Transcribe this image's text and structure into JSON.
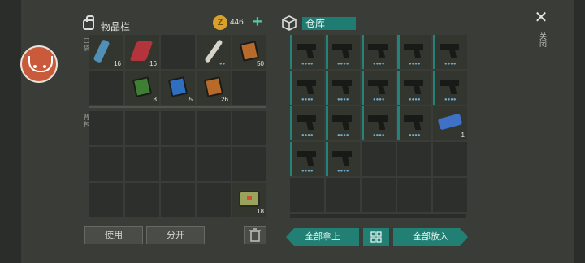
{
  "inventory": {
    "title": "物品栏",
    "coins": "446",
    "pocket_label": "口袋",
    "backpack_label": "背包",
    "pocket_items": [
      {
        "name": "water-bottle",
        "qty": "16",
        "color": "#4f8fb8"
      },
      {
        "name": "red-cloth",
        "qty": "16",
        "color": "#b3343a"
      },
      {
        "name": "empty",
        "qty": ""
      },
      {
        "name": "machete",
        "qty": "",
        "color": "#d6d3c8"
      },
      {
        "name": "notebook-orange",
        "qty": "50",
        "color": "#b86a2b"
      },
      {
        "name": "empty",
        "qty": ""
      },
      {
        "name": "green-book",
        "qty": "8",
        "color": "#3f7f33"
      },
      {
        "name": "blue-book",
        "qty": "5",
        "color": "#2f6fbf"
      },
      {
        "name": "orange-book",
        "qty": "26",
        "color": "#b86a2b"
      },
      {
        "name": "empty",
        "qty": ""
      }
    ],
    "backpack_items_qty": [
      "",
      "",
      "",
      "",
      "",
      "",
      "",
      "",
      "",
      "",
      "",
      "",
      "",
      "",
      "18"
    ],
    "use_label": "使用",
    "split_label": "分开"
  },
  "warehouse": {
    "title": "仓库",
    "slots": [
      {
        "type": "gun"
      },
      {
        "type": "gun"
      },
      {
        "type": "gun"
      },
      {
        "type": "gun"
      },
      {
        "type": "gun"
      },
      {
        "type": "gun"
      },
      {
        "type": "gun"
      },
      {
        "type": "gun"
      },
      {
        "type": "gun"
      },
      {
        "type": "gun"
      },
      {
        "type": "gun"
      },
      {
        "type": "gun"
      },
      {
        "type": "gun"
      },
      {
        "type": "gun"
      },
      {
        "type": "toy-tank",
        "qty": "1"
      },
      {
        "type": "gun"
      },
      {
        "type": "gun"
      },
      {
        "type": "empty"
      },
      {
        "type": "empty"
      },
      {
        "type": "empty"
      },
      {
        "type": "empty"
      },
      {
        "type": "empty"
      },
      {
        "type": "empty"
      },
      {
        "type": "empty"
      },
      {
        "type": "empty"
      }
    ],
    "take_all_label": "全部拿上",
    "put_all_label": "全部放入"
  },
  "close_label": "关闭",
  "colors": {
    "accent": "#217f74",
    "coin": "#d9a12a",
    "avatar": "#c95b3c"
  }
}
